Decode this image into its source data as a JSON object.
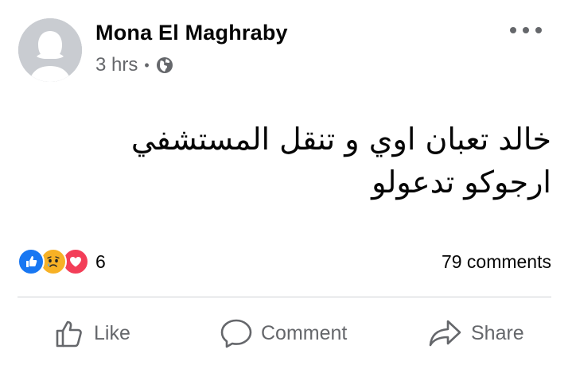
{
  "post": {
    "author": "Mona El Maghraby",
    "time": "3 hrs",
    "separator": "•",
    "privacy_icon": "globe-icon",
    "body_lines": [
      "خالد تعبان اوي و تنقل المستشفي",
      "ارجوكو تدعولو"
    ]
  },
  "stats": {
    "reaction_icons": [
      "like-icon",
      "sad-icon",
      "love-icon"
    ],
    "reaction_count": "6",
    "comments": "79 comments"
  },
  "actions": {
    "like": "Like",
    "comment": "Comment",
    "share": "Share"
  },
  "colors": {
    "text_primary": "#050505",
    "text_secondary": "#65676b",
    "like_blue": "#1877f2",
    "sad_yellow": "#f7b125",
    "love_red": "#f33e58",
    "divider": "#ced0d4",
    "avatar_bg": "#c9ccd1"
  }
}
